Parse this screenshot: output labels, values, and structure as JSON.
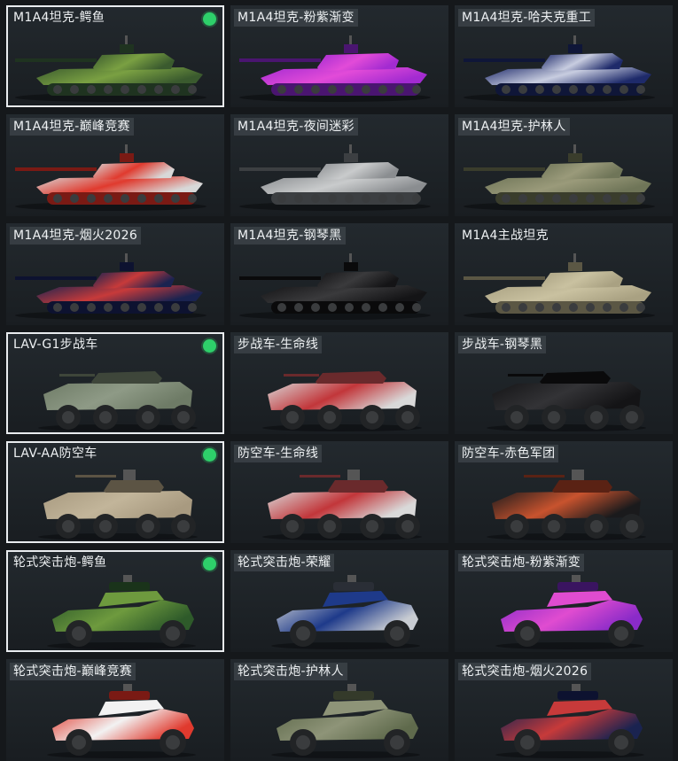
{
  "items": [
    {
      "label": "M1A4坦克-鳄鱼",
      "selected": true,
      "equipped": true,
      "tagged": false,
      "kind": "tank",
      "colors": [
        "#3a5a2e",
        "#7aa042",
        "#1f3320"
      ]
    },
    {
      "label": "M1A4坦克-粉紫渐变",
      "selected": false,
      "equipped": false,
      "tagged": true,
      "kind": "tank",
      "colors": [
        "#a32bd1",
        "#e24bd8",
        "#4a1570"
      ]
    },
    {
      "label": "M1A4坦克-哈夫克重工",
      "selected": false,
      "equipped": false,
      "tagged": true,
      "kind": "tank",
      "colors": [
        "#1e2a6a",
        "#c8cde0",
        "#0f1638"
      ]
    },
    {
      "label": "M1A4坦克-巅峰竞赛",
      "selected": false,
      "equipped": false,
      "tagged": true,
      "kind": "tank",
      "colors": [
        "#d8d8d8",
        "#e03a2e",
        "#7a1a14"
      ]
    },
    {
      "label": "M1A4坦克-夜间迷彩",
      "selected": false,
      "equipped": false,
      "tagged": true,
      "kind": "tank",
      "colors": [
        "#8a8d90",
        "#c9cbcc",
        "#3c3f42"
      ]
    },
    {
      "label": "M1A4坦克-护林人",
      "selected": false,
      "equipped": false,
      "tagged": true,
      "kind": "tank",
      "colors": [
        "#6f7558",
        "#9a9a7a",
        "#3a3d2c"
      ]
    },
    {
      "label": "M1A4坦克-烟火2026",
      "selected": false,
      "equipped": false,
      "tagged": true,
      "kind": "tank",
      "colors": [
        "#1a2350",
        "#c73a3a",
        "#0d1230"
      ]
    },
    {
      "label": "M1A4坦克-钢琴黑",
      "selected": false,
      "equipped": false,
      "tagged": true,
      "kind": "tank",
      "colors": [
        "#141416",
        "#3a3a3c",
        "#0a0a0b"
      ]
    },
    {
      "label": "M1A4主战坦克",
      "selected": false,
      "equipped": false,
      "tagged": false,
      "kind": "tank",
      "colors": [
        "#a9a182",
        "#c9c1a0",
        "#5b5744"
      ]
    },
    {
      "label": "LAV-G1步战车",
      "selected": true,
      "equipped": true,
      "tagged": false,
      "kind": "apc",
      "colors": [
        "#6e7b66",
        "#8e9a86",
        "#3e463a"
      ]
    },
    {
      "label": "步战车-生命线",
      "selected": false,
      "equipped": false,
      "tagged": true,
      "kind": "apc",
      "colors": [
        "#d9d9d9",
        "#c2363a",
        "#6a2a2c"
      ]
    },
    {
      "label": "步战车-钢琴黑",
      "selected": false,
      "equipped": false,
      "tagged": true,
      "kind": "apc",
      "colors": [
        "#141416",
        "#333336",
        "#0a0a0b"
      ]
    },
    {
      "label": "LAV-AA防空车",
      "selected": true,
      "equipped": true,
      "tagged": false,
      "kind": "aa",
      "colors": [
        "#a89a80",
        "#c2b59a",
        "#5c5444"
      ]
    },
    {
      "label": "防空车-生命线",
      "selected": false,
      "equipped": false,
      "tagged": true,
      "kind": "aa",
      "colors": [
        "#d9d9d9",
        "#c2363a",
        "#6a2a2c"
      ]
    },
    {
      "label": "防空车-赤色军团",
      "selected": false,
      "equipped": false,
      "tagged": true,
      "kind": "aa",
      "colors": [
        "#1a1a1c",
        "#c8532e",
        "#5a2214"
      ]
    },
    {
      "label": "轮式突击炮-鳄鱼",
      "selected": true,
      "equipped": true,
      "tagged": false,
      "kind": "car",
      "colors": [
        "#2e5a2a",
        "#6e9a3e",
        "#1a331a"
      ]
    },
    {
      "label": "轮式突击炮-荣耀",
      "selected": false,
      "equipped": false,
      "tagged": true,
      "kind": "car",
      "colors": [
        "#c8ccd2",
        "#1e3a8a",
        "#2a2e36"
      ]
    },
    {
      "label": "轮式突击炮-粉紫渐变",
      "selected": false,
      "equipped": false,
      "tagged": true,
      "kind": "car",
      "colors": [
        "#8a2bc8",
        "#e04cd0",
        "#3a1460"
      ]
    },
    {
      "label": "轮式突击炮-巅峰竞赛",
      "selected": false,
      "equipped": false,
      "tagged": true,
      "kind": "car",
      "colors": [
        "#e03a2e",
        "#f2f2f2",
        "#7a1a14"
      ]
    },
    {
      "label": "轮式突击炮-护林人",
      "selected": false,
      "equipped": false,
      "tagged": true,
      "kind": "car",
      "colors": [
        "#5f6a4c",
        "#8e9478",
        "#343a2a"
      ]
    },
    {
      "label": "轮式突击炮-烟火2026",
      "selected": false,
      "equipped": false,
      "tagged": true,
      "kind": "car",
      "colors": [
        "#1a2350",
        "#c73a3a",
        "#0d1230"
      ]
    }
  ]
}
